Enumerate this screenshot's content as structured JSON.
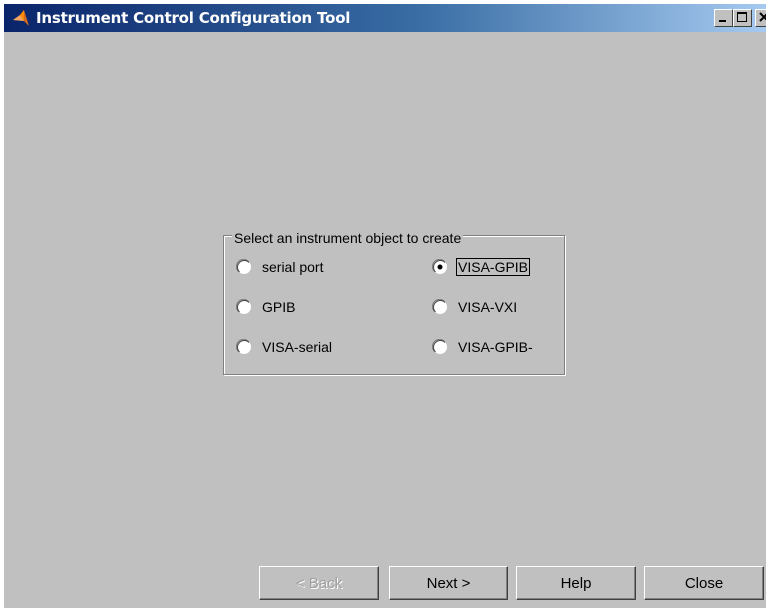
{
  "window": {
    "title": "Instrument Control Configuration Tool",
    "icon": "matlab-logo-icon",
    "controls": [
      "minimize-icon",
      "maximize-icon",
      "close-icon"
    ]
  },
  "group": {
    "title": "Select an instrument object to create",
    "options": [
      {
        "label": "serial port",
        "selected": false
      },
      {
        "label": "VISA-GPIB",
        "selected": true
      },
      {
        "label": "GPIB",
        "selected": false
      },
      {
        "label": "VISA-VXI",
        "selected": false
      },
      {
        "label": "VISA-serial",
        "selected": false
      },
      {
        "label": "VISA-GPIB-",
        "selected": false
      }
    ]
  },
  "buttons": {
    "back": {
      "label": "< Back",
      "enabled": false
    },
    "next": {
      "label": "Next >",
      "enabled": true
    },
    "help": {
      "label": "Help",
      "enabled": true
    },
    "close": {
      "label": "Close",
      "enabled": true
    }
  },
  "colors": {
    "face": "#c0c0c0",
    "titlebar_start": "#0a246a",
    "titlebar_end": "#a6caf0"
  }
}
